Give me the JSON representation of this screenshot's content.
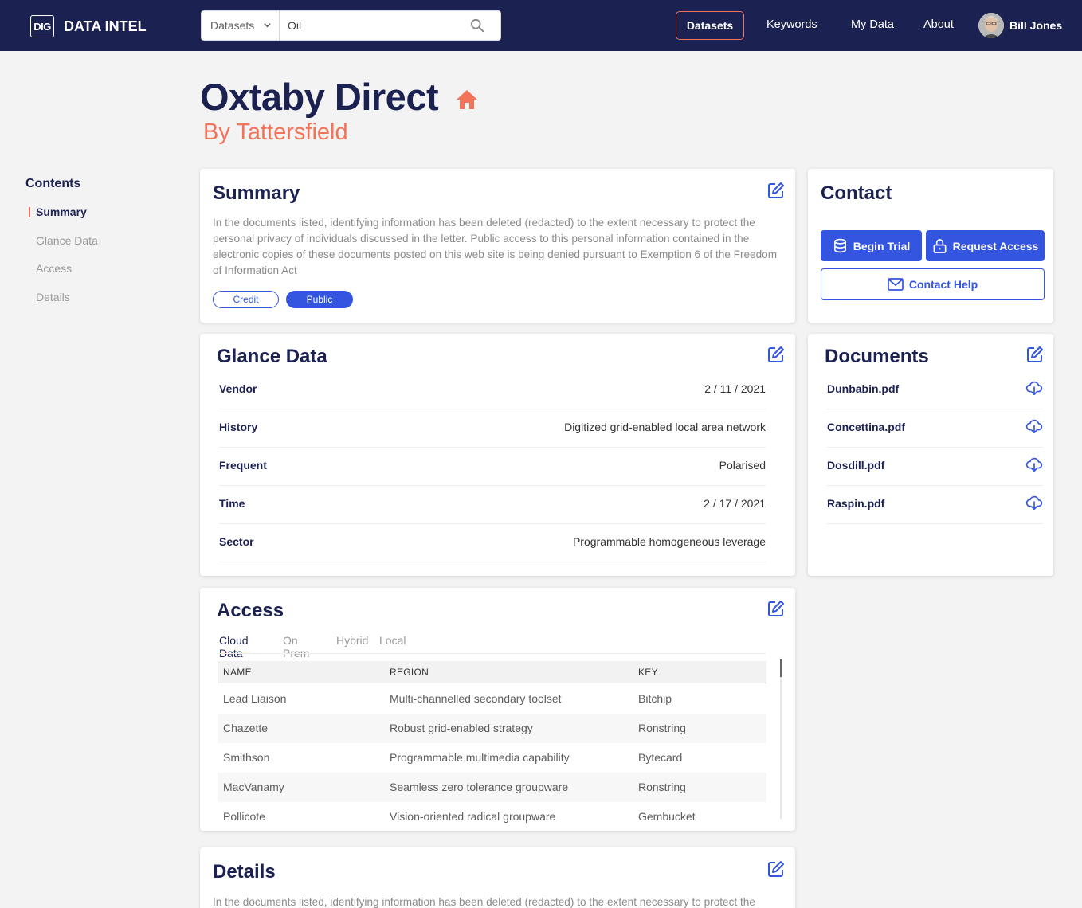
{
  "app": {
    "logo_text": "DIG",
    "brand": "DATA INTEL"
  },
  "search": {
    "category": "Datasets",
    "value": "Oil",
    "placeholder": ""
  },
  "nav": {
    "active": "Datasets",
    "links": [
      "Keywords",
      "My Data",
      "About"
    ],
    "user": "Bill Jones"
  },
  "header": {
    "title": "Oxtaby Direct",
    "subtitle": "By Tattersfield"
  },
  "toc": {
    "title": "Contents",
    "items": [
      "Summary",
      "Glance Data",
      "Access",
      "Details"
    ]
  },
  "summary": {
    "title": "Summary",
    "text": "In the documents listed, identifying information has been deleted (redacted) to the extent necessary to protect the personal privacy of individuals discussed in the letter. Public access to this personal information contained in the electronic copies of these documents posted on this web site is being denied pursuant to Exemption 6 of the Freedom of Information Act",
    "tags": [
      "Credit",
      "Public"
    ]
  },
  "glance": {
    "title": "Glance Data",
    "rows": [
      {
        "key": "Vendor",
        "value": "2 / 11 / 2021"
      },
      {
        "key": "History",
        "value": "Digitized grid-enabled local area network"
      },
      {
        "key": "Frequent",
        "value": "Polarised"
      },
      {
        "key": "Time",
        "value": "2 / 17 / 2021"
      },
      {
        "key": "Sector",
        "value": "Programmable homogeneous leverage"
      }
    ]
  },
  "access": {
    "title": "Access",
    "tabs": [
      "Cloud Data",
      "On Prem",
      "Hybrid",
      "Local"
    ],
    "columns": [
      "NAME",
      "REGION",
      "KEY"
    ],
    "rows": [
      [
        "Lead Liaison",
        "Multi-channelled secondary toolset",
        "Bitchip"
      ],
      [
        "Chazette",
        "Robust grid-enabled strategy",
        "Ronstring"
      ],
      [
        "Smithson",
        "Programmable multimedia capability",
        "Bytecard"
      ],
      [
        "MacVanamy",
        "Seamless zero tolerance groupware",
        "Ronstring"
      ],
      [
        "Pollicote",
        "Vision-oriented radical groupware",
        "Gembucket"
      ]
    ]
  },
  "details": {
    "title": "Details",
    "text": "In the documents listed, identifying information has been deleted (redacted) to the extent necessary to protect the"
  },
  "contact": {
    "title": "Contact",
    "begin_trial": "Begin Trial",
    "request_access": "Request Access",
    "contact_help": "Contact Help"
  },
  "documents": {
    "title": "Documents",
    "files": [
      "Dunbabin.pdf",
      "Concettina.pdf",
      "Dosdill.pdf",
      "Raspin.pdf"
    ]
  },
  "colors": {
    "navy": "#1b2150",
    "accent": "#f2735a",
    "primary": "#3455e0"
  }
}
